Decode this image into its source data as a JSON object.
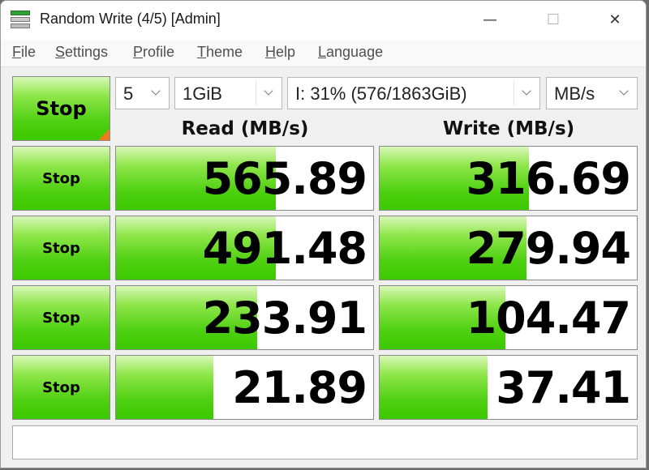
{
  "window": {
    "title": "Random Write (4/5) [Admin]",
    "controls": {
      "minimize": "—",
      "maximize": "☐",
      "close": "✕"
    }
  },
  "menu": [
    {
      "label": "File",
      "accel": "F",
      "rest": "ile"
    },
    {
      "label": "Settings",
      "accel": "S",
      "rest": "ettings"
    },
    {
      "label": "Profile",
      "accel": "P",
      "rest": "rofile"
    },
    {
      "label": "Theme",
      "accel": "T",
      "rest": "heme"
    },
    {
      "label": "Help",
      "accel": "H",
      "rest": "elp"
    },
    {
      "label": "Language",
      "accel": "L",
      "rest": "anguage"
    }
  ],
  "controls": {
    "main_button": "Stop",
    "count": "5",
    "size": "1GiB",
    "drive": "I: 31% (576/1863GiB)",
    "unit": "MB/s"
  },
  "headers": {
    "read": "Read (MB/s)",
    "write": "Write (MB/s)"
  },
  "rows": [
    {
      "button": "Stop",
      "read": "565.89",
      "write": "316.69",
      "read_level": 0.62,
      "write_level": 0.58
    },
    {
      "button": "Stop",
      "read": "491.48",
      "write": "279.94",
      "read_level": 0.62,
      "write_level": 0.57
    },
    {
      "button": "Stop",
      "read": "233.91",
      "write": "104.47",
      "read_level": 0.55,
      "write_level": 0.49
    },
    {
      "button": "Stop",
      "read": "21.89",
      "write": "37.41",
      "read_level": 0.38,
      "write_level": 0.42
    }
  ],
  "colors": {
    "accent_green": "#3cc900",
    "corner_orange": "#f07a1f"
  },
  "comment": ""
}
